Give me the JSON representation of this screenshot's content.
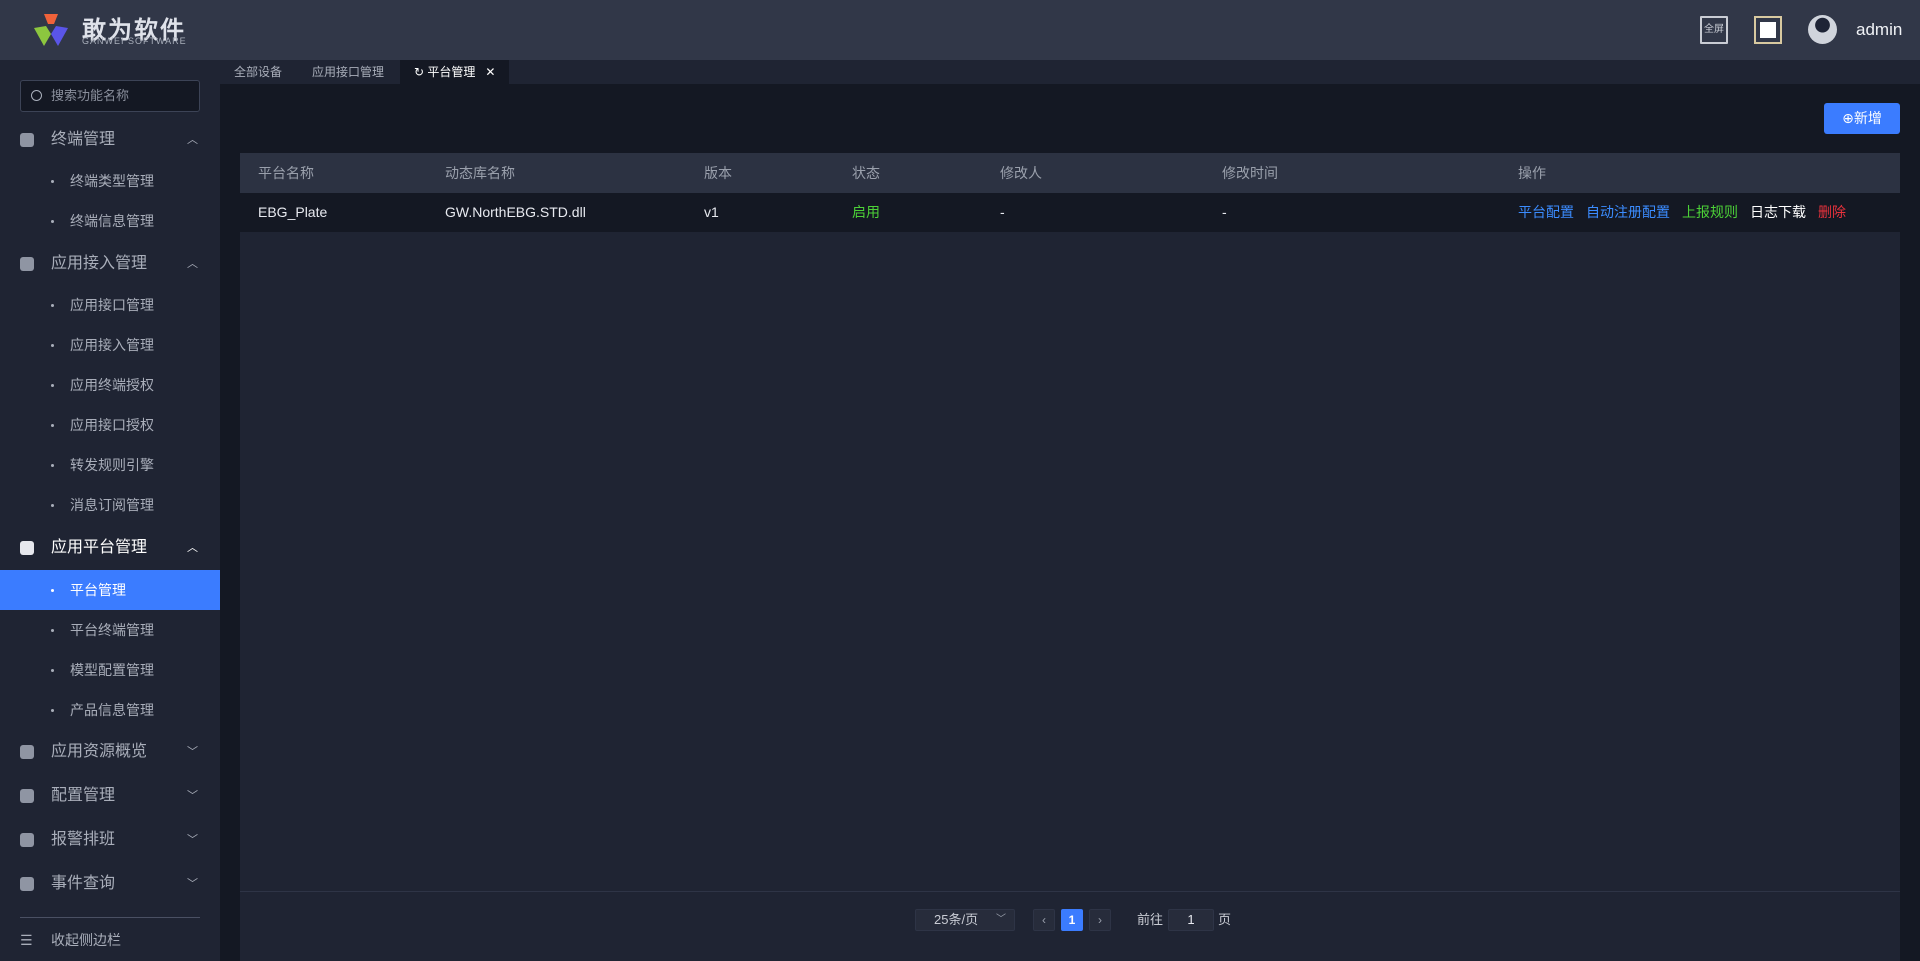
{
  "header": {
    "brand": "敢为软件",
    "brand_sub": "GANWEI SOFTWARE",
    "fullscreen_label": "全屏",
    "username": "admin"
  },
  "sidebar": {
    "search_placeholder": "搜索功能名称",
    "groups": [
      {
        "label": "终端管理",
        "items": [
          "终端类型管理",
          "终端信息管理"
        ]
      },
      {
        "label": "应用接入管理",
        "items": [
          "应用接口管理",
          "应用接入管理",
          "应用终端授权",
          "应用接口授权",
          "转发规则引擎",
          "消息订阅管理"
        ]
      },
      {
        "label": "应用平台管理",
        "items": [
          "平台管理",
          "平台终端管理",
          "模型配置管理",
          "产品信息管理"
        ]
      },
      {
        "label": "应用资源概览"
      },
      {
        "label": "配置管理"
      },
      {
        "label": "报警排班"
      },
      {
        "label": "事件查询"
      }
    ],
    "collapse_label": "收起侧边栏"
  },
  "tabs": [
    {
      "label": "全部设备"
    },
    {
      "label": "应用接口管理"
    },
    {
      "label": "平台管理",
      "active": true
    }
  ],
  "toolbar": {
    "add_label": "新增"
  },
  "table": {
    "columns": [
      "平台名称",
      "动态库名称",
      "版本",
      "状态",
      "修改人",
      "修改时间",
      "操作"
    ],
    "rows": [
      {
        "name": "EBG_Plate",
        "dll": "GW.NorthEBG.STD.dll",
        "version": "v1",
        "status": "启用",
        "modifier": "-",
        "modified_time": "-",
        "actions": [
          "平台配置",
          "自动注册配置",
          "上报规则",
          "日志下载",
          "删除"
        ]
      }
    ]
  },
  "pagination": {
    "page_size": "25条/页",
    "current_page": "1",
    "goto_label": "前往",
    "goto_value": "1",
    "page_suffix": "页"
  },
  "colors": {
    "accent": "#3b7cff",
    "status_green": "#4cd137",
    "delete_red": "#e8323c"
  }
}
